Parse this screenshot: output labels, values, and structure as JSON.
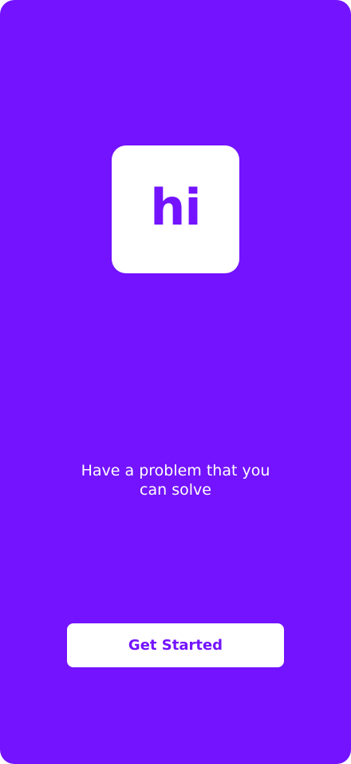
{
  "colors": {
    "background": "#7313ff",
    "surface": "#ffffff",
    "accent": "#7313ff",
    "text_on_background": "#ffffff"
  },
  "logo": {
    "text": "hi"
  },
  "tagline": {
    "line1": "Have a problem that you",
    "line2": "can solve"
  },
  "cta": {
    "label": "Get Started"
  }
}
